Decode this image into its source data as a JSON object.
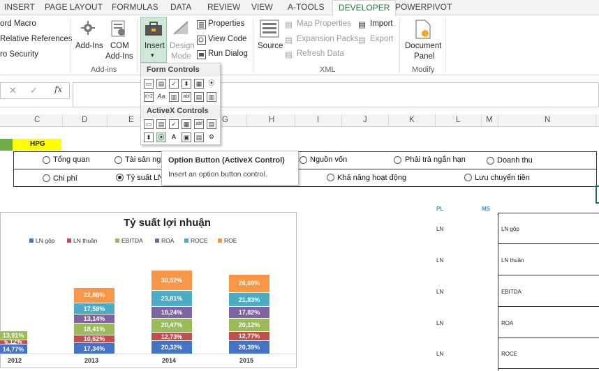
{
  "tabs": [
    "INSERT",
    "PAGE LAYOUT",
    "FORMULAS",
    "DATA",
    "REVIEW",
    "VIEW",
    "A-TOOLS",
    "DEVELOPER",
    "POWERPIVOT"
  ],
  "ribbon": {
    "code": {
      "record_macro": "ord Macro",
      "relative_refs": "Relative References",
      "macro_security": "ro Security"
    },
    "addins": {
      "addins": "Add-Ins",
      "com_addins_1": "COM",
      "com_addins_2": "Add-Ins",
      "group": "Add-ins"
    },
    "controls": {
      "insert": "Insert",
      "insert_arrow": "▾",
      "design_mode_1": "Design",
      "design_mode_2": "Mode",
      "properties": "Properties",
      "view_code": "View Code",
      "run_dialog": "Run Dialog"
    },
    "xml": {
      "source": "Source",
      "map_properties": "Map Properties",
      "expansion_packs": "Expansion Packs",
      "refresh_data": "Refresh Data",
      "import": "Import",
      "export": "Export",
      "group": "XML"
    },
    "modify": {
      "doc_panel_1": "Document",
      "doc_panel_2": "Panel",
      "group": "Modify"
    }
  },
  "formula_bar": {
    "cancel": "✕",
    "enter": "✓",
    "fx": "fx",
    "value": ""
  },
  "columns": [
    "C",
    "D",
    "E",
    "F",
    "G",
    "H",
    "I",
    "J",
    "K",
    "L",
    "M",
    "N"
  ],
  "cell_hpg": "HPG",
  "options_row1": [
    "Tổng quan",
    "Tài sản ngắ",
    "Nguồn vốn",
    "Phải trả ngắn hạn",
    "Doanh thu"
  ],
  "options_row2": [
    "Chi phí",
    "Tỷ suất LN",
    "Khả năng hoạt động",
    "Lưu chuyển tiền"
  ],
  "dropdown": {
    "form_controls": "Form Controls",
    "activex_controls": "ActiveX Controls",
    "form_row1": [
      "▭",
      "▤",
      "✓",
      "⬍",
      "▦",
      "⦿"
    ],
    "form_row2": [
      "XYZ",
      "Aa",
      "▥",
      "abl",
      "▤",
      "▥"
    ],
    "ax_row1": [
      "▭",
      "▤",
      "✓",
      "▦",
      "abl",
      "▤"
    ],
    "ax_row2": [
      "⬍",
      "⦿",
      "A",
      "▣",
      "▤",
      "⚙"
    ]
  },
  "tooltip": {
    "title": "Option Button (ActiveX Control)",
    "desc": "Insert an option button control."
  },
  "chart_data": {
    "type": "bar",
    "title": "Tỷ suất lợi nhuận",
    "stacked": true,
    "categories": [
      "2012",
      "2013",
      "2014",
      "2015"
    ],
    "series": [
      {
        "name": "LN gộp",
        "color": "#4472c4",
        "values": [
          14.77,
          17.34,
          20.32,
          20.39
        ]
      },
      {
        "name": "LN thuần",
        "color": "#c0504d",
        "values": [
          6.12,
          10.62,
          12.73,
          12.77
        ]
      },
      {
        "name": "EBITDA",
        "color": "#9bbb59",
        "values": [
          13.91,
          18.41,
          20.47,
          20.12
        ]
      },
      {
        "name": "ROA",
        "color": "#8064a2",
        "values": [
          null,
          13.14,
          18.24,
          17.82
        ]
      },
      {
        "name": "ROCE",
        "color": "#4bacc6",
        "values": [
          null,
          17.58,
          23.81,
          21.83
        ]
      },
      {
        "name": "ROE",
        "color": "#f79646",
        "values": [
          null,
          22.86,
          30.52,
          26.69
        ]
      }
    ],
    "labels": [
      [
        "14,77%",
        "6,12%",
        "13,91%",
        "",
        "",
        ""
      ],
      [
        "17,34%",
        "10,62%",
        "18,41%",
        "13,14%",
        "17,58%",
        "22,86%"
      ],
      [
        "20,32%",
        "12,73%",
        "20,47%",
        "18,24%",
        "23,81%",
        "30,52%"
      ],
      [
        "20,39%",
        "12,77%",
        "20,12%",
        "17,82%",
        "21,83%",
        "26,69%"
      ]
    ]
  },
  "right_table": {
    "hdr_pl": "PL",
    "hdr_ms": "MS",
    "rows": [
      {
        "pl": "LN",
        "ms": "LN gộp"
      },
      {
        "pl": "LN",
        "ms": "LN thuần"
      },
      {
        "pl": "LN",
        "ms": "EBITDA"
      },
      {
        "pl": "LN",
        "ms": "ROA"
      },
      {
        "pl": "LN",
        "ms": "ROCE"
      }
    ]
  }
}
